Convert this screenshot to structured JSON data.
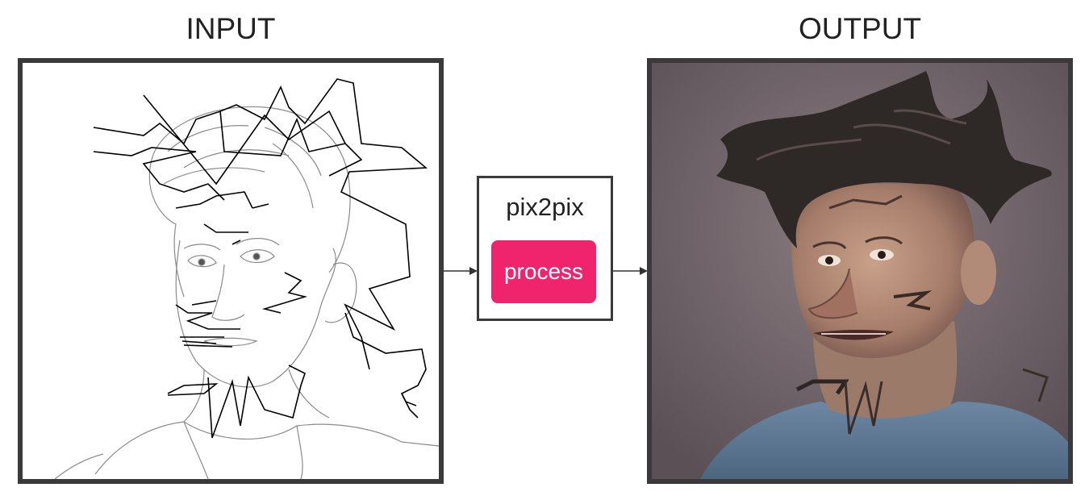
{
  "input_panel": {
    "title": "INPUT"
  },
  "output_panel": {
    "title": "OUTPUT"
  },
  "model": {
    "name": "pix2pix",
    "process_label": "process"
  },
  "colors": {
    "accent": "#f0246d",
    "frame": "#3a3a3a"
  }
}
